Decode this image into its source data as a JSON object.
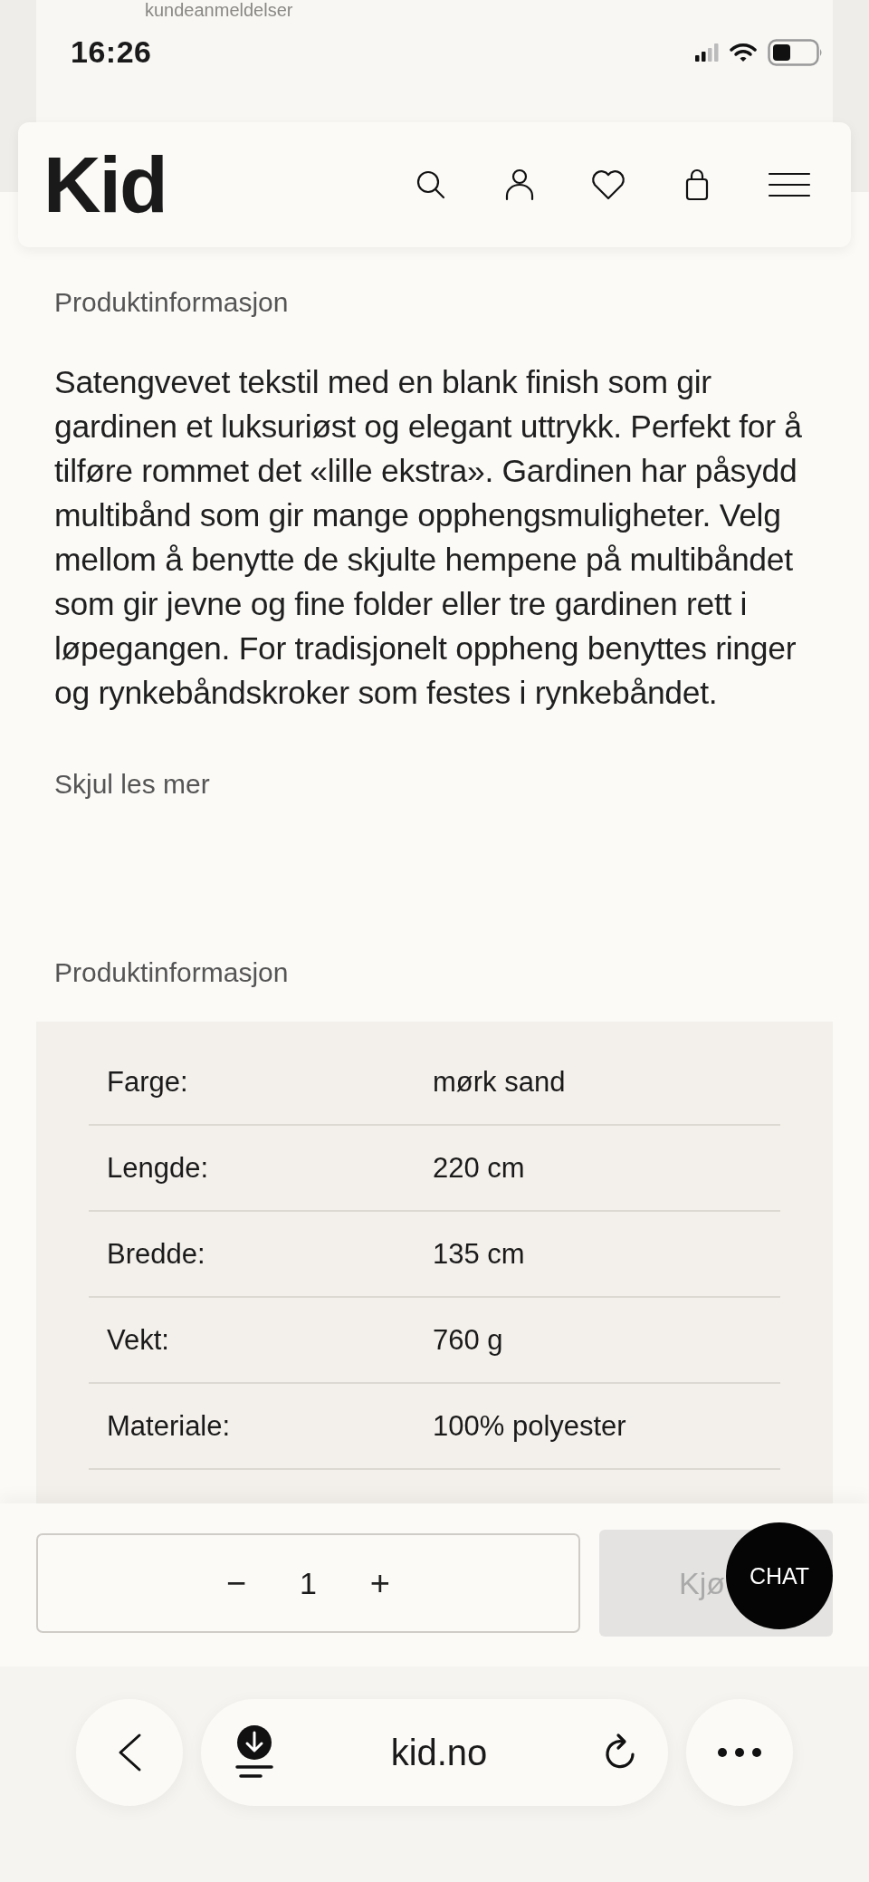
{
  "top_card": {
    "text": "kundeanmeldelser"
  },
  "status_bar": {
    "time": "16:26"
  },
  "header": {
    "logo": "Kid"
  },
  "description": {
    "heading": "Produktinformasjon",
    "text": "Satengvevet tekstil med en blank finish som gir gardinen et luksuriøst og elegant uttrykk. Perfekt for å tilføre rommet det «lille ekstra». Gardinen har påsydd multibånd som gir mange opphengsmuligheter. Velg mellom å benytte de skjulte hempene på multibåndet som gir jevne og fine folder eller tre gardinen rett i løpegangen. For tradisjonelt oppheng benyttes ringer og rynkebåndskroker som festes i rynkebåndet.",
    "toggle": "Skjul les mer"
  },
  "specs": {
    "heading": "Produktinformasjon",
    "rows": [
      {
        "label": "Farge:",
        "value": "mørk sand"
      },
      {
        "label": "Lengde:",
        "value": "220 cm"
      },
      {
        "label": "Bredde:",
        "value": "135 cm"
      },
      {
        "label": "Vekt:",
        "value": "760 g"
      },
      {
        "label": "Materiale:",
        "value": "100% polyester"
      }
    ]
  },
  "purchase": {
    "decrement": "−",
    "quantity": "1",
    "increment": "+",
    "buy_button": {
      "label": "Kjø",
      "disabled": true
    },
    "chat_button": "CHAT"
  },
  "browser": {
    "url": "kid.no"
  }
}
